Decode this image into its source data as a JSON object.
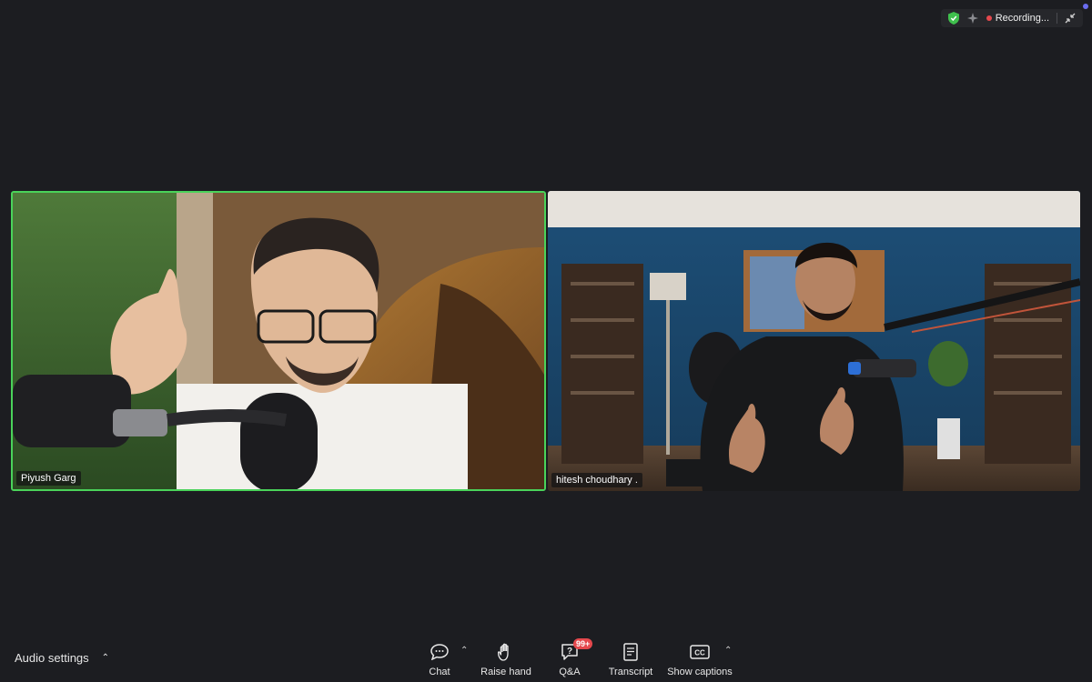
{
  "status": {
    "recording_label": "Recording...",
    "icons": [
      "shield-check-icon",
      "sparkle-icon",
      "exit-fullscreen-icon"
    ],
    "colors": {
      "shield": "#3fbf4d",
      "record_dot": "#e5484d",
      "notify": "#6a6cf0"
    }
  },
  "participants": [
    {
      "name": "Piyush Garg",
      "active_speaker": true,
      "speaker_border": "#4ad35a"
    },
    {
      "name": "hitesh choudhary .",
      "active_speaker": false
    }
  ],
  "audio": {
    "label": "Audio settings"
  },
  "toolbar": {
    "chat": "Chat",
    "raise_hand": "Raise hand",
    "qa": "Q&A",
    "qa_badge": "99+",
    "transcript": "Transcript",
    "show_captions": "Show captions",
    "captions_icon_text": "CC"
  }
}
